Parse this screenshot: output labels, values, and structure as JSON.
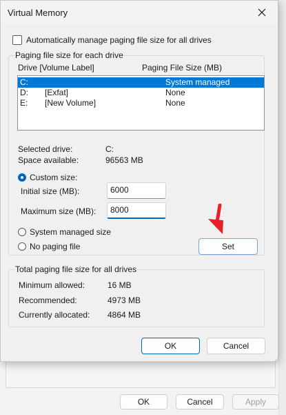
{
  "dialog": {
    "title": "Virtual Memory"
  },
  "auto_manage": {
    "label": "Automatically manage paging file size for all drives",
    "checked": false
  },
  "paging_group": {
    "label": "Paging file size for each drive",
    "header_drive": "Drive  [Volume Label]",
    "header_size": "Paging File Size (MB)",
    "drives": [
      {
        "drive": "C:",
        "label": "",
        "size": "System managed",
        "selected": true
      },
      {
        "drive": "D:",
        "label": "[Exfat]",
        "size": "None",
        "selected": false
      },
      {
        "drive": "E:",
        "label": "[New Volume]",
        "size": "None",
        "selected": false
      }
    ],
    "selected_drive_label": "Selected drive:",
    "selected_drive_value": "C:",
    "space_label": "Space available:",
    "space_value": "96563 MB",
    "custom_size_label": "Custom size:",
    "initial_label": "Initial size (MB):",
    "initial_value": "6000",
    "maximum_label": "Maximum size (MB):",
    "maximum_value": "8000",
    "system_managed_label": "System managed size",
    "no_paging_label": "No paging file",
    "set_label": "Set",
    "selected_option": "custom"
  },
  "total_group": {
    "label": "Total paging file size for all drives",
    "min_label": "Minimum allowed:",
    "min_value": "16 MB",
    "rec_label": "Recommended:",
    "rec_value": "4973 MB",
    "cur_label": "Currently allocated:",
    "cur_value": "4864 MB"
  },
  "footer": {
    "ok": "OK",
    "cancel": "Cancel"
  },
  "parent_footer": {
    "ok": "OK",
    "cancel": "Cancel",
    "apply": "Apply"
  },
  "colors": {
    "accent": "#0067c0",
    "selection": "#0078d7",
    "arrow": "#e8202a"
  }
}
